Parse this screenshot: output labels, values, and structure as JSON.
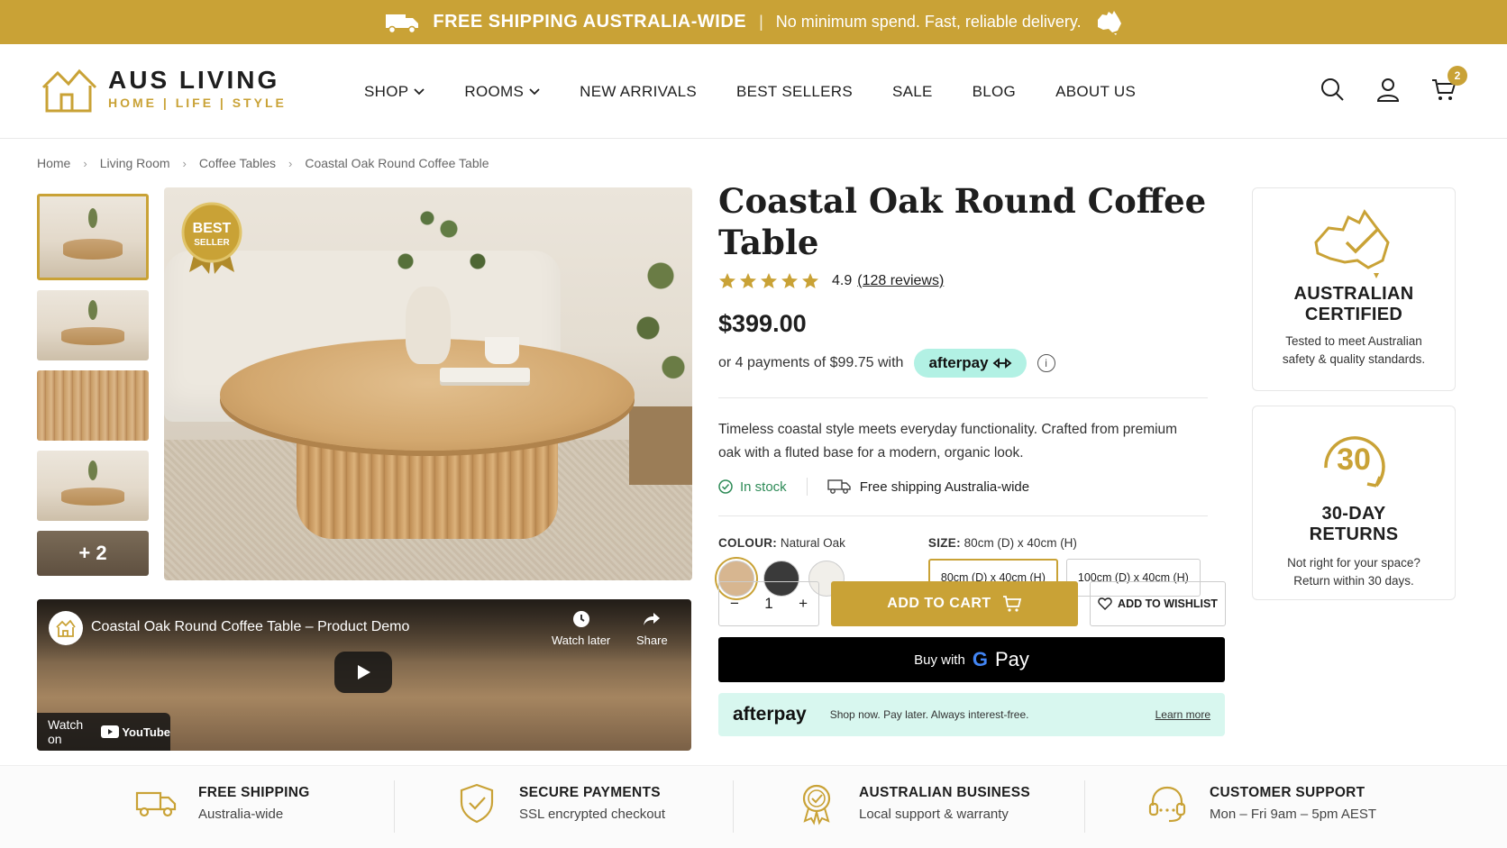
{
  "colors": {
    "gold": "#c9a236",
    "afterpay": "#b2f1e4",
    "afterpay_bg": "#d8f7ef",
    "stock_green": "#2e8b57"
  },
  "promo": {
    "bold": "FREE SHIPPING AUSTRALIA-WIDE",
    "sep": "|",
    "text": "No minimum spend. Fast, reliable delivery."
  },
  "logo": {
    "name": "AUS LIVING",
    "tagline": "HOME | LIFE | STYLE"
  },
  "nav": {
    "items": [
      "SHOP",
      "ROOMS",
      "NEW ARRIVALS",
      "BEST SELLERS",
      "SALE",
      "BLOG",
      "ABOUT US"
    ]
  },
  "header": {
    "cart_count": "2"
  },
  "breadcrumb": [
    "Home",
    "Living Room",
    "Coffee Tables",
    "Coastal Oak Round Coffee Table"
  ],
  "gallery": {
    "more_label": "+ 2",
    "badge_line1": "BEST",
    "badge_line2": "SELLER"
  },
  "video": {
    "title": "Coastal Oak Round Coffee Table – Product Demo",
    "watch_later": "Watch later",
    "share": "Share",
    "watch_on": "Watch on",
    "youtube": "YouTube"
  },
  "product": {
    "title": "Coastal Oak Round Coffee Table",
    "rating": "4.9",
    "rating_value": 4.9,
    "reviews": "(128 reviews)",
    "price": "$399.00",
    "installments": "or 4 payments of $99.75 with",
    "afterpay_label": "afterpay",
    "description": "Timeless coastal style meets everyday functionality. Crafted from premium oak with a fluted base for a modern, organic look.",
    "stock": "In stock",
    "shipping": "Free shipping Australia-wide",
    "colour_label": "COLOUR:",
    "colour_value": "Natural Oak",
    "size_label": "SIZE:",
    "size_value": "80cm (D) x 40cm (H)",
    "sizes": [
      "80cm (D) x 40cm (H)",
      "100cm (D) x 40cm (H)"
    ],
    "swatch_colors": [
      "#d7b690",
      "#3a3a3a",
      "#f1efea"
    ],
    "quantity": "1",
    "add_to_cart": "ADD TO CART",
    "add_to_wishlist": "ADD TO WISHLIST",
    "buy_with": "Buy with",
    "gpay_g": "G",
    "gpay_pay": "Pay",
    "afterpay_bar_text": "Shop now. Pay later. Always interest-free.",
    "learn_more": "Learn more"
  },
  "trust": [
    {
      "title_line1": "AUSTRALIAN",
      "title_line2": "CERTIFIED",
      "sub_line1": "Tested to meet Australian",
      "sub_line2": "safety & quality standards.",
      "icon": "australia-check-icon"
    },
    {
      "number": "30",
      "title_line1": "30-DAY",
      "title_line2": "RETURNS",
      "sub_line1": "Not right for your space?",
      "sub_line2": "Return within 30 days.",
      "icon": "returns-icon"
    }
  ],
  "features": [
    {
      "title": "FREE SHIPPING",
      "sub": "Australia-wide",
      "icon": "truck-icon"
    },
    {
      "title": "SECURE PAYMENTS",
      "sub": "SSL encrypted checkout",
      "icon": "shield-icon"
    },
    {
      "title": "AUSTRALIAN BUSINESS",
      "sub": "Local support & warranty",
      "icon": "award-icon"
    },
    {
      "title": "CUSTOMER SUPPORT",
      "sub": "Mon – Fri 9am – 5pm AEST",
      "icon": "headset-icon"
    }
  ]
}
